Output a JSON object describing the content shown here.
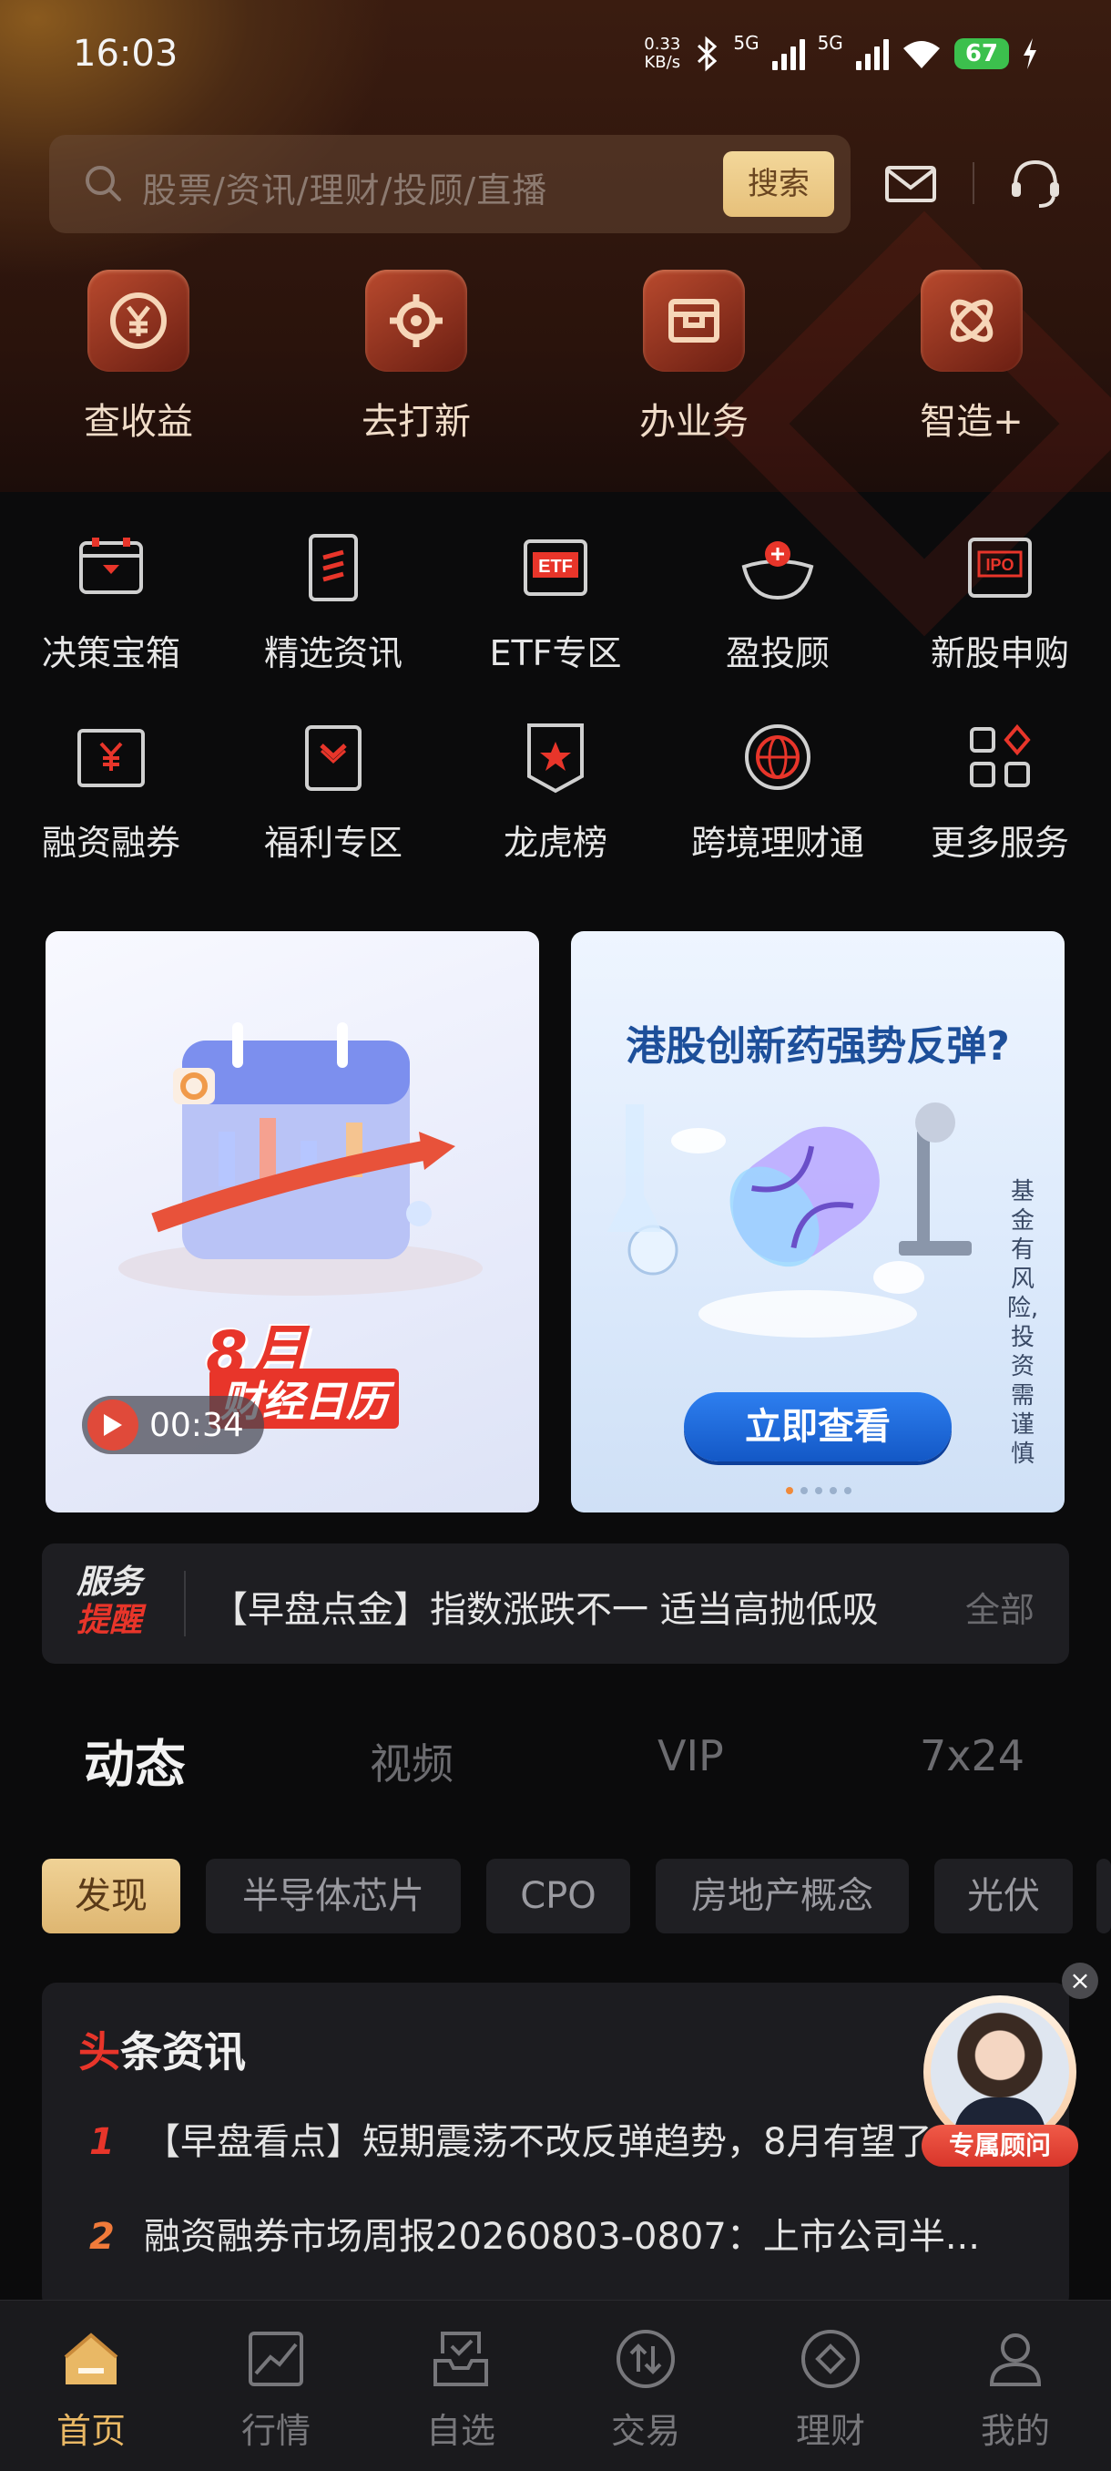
{
  "status_bar": {
    "time": "16:03",
    "net_speed": "0.33",
    "net_unit": "KB/s",
    "net1": "5G",
    "net2": "5G",
    "battery": "67"
  },
  "search": {
    "placeholder": "股票/资讯/理财/投顾/直播",
    "button": "搜索"
  },
  "quick_actions": [
    {
      "label": "查收益",
      "icon": "yen-coin-icon"
    },
    {
      "label": "去打新",
      "icon": "target-icon"
    },
    {
      "label": "办业务",
      "icon": "briefcase-icon"
    },
    {
      "label": "智造+",
      "icon": "atom-icon"
    }
  ],
  "menu_grid": [
    {
      "label": "决策宝箱",
      "icon": "treasure-box-icon"
    },
    {
      "label": "精选资讯",
      "icon": "news-doc-icon"
    },
    {
      "label": "ETF专区",
      "icon": "etf-icon",
      "icon_text": "ETF"
    },
    {
      "label": "盈投顾",
      "icon": "advisor-bowl-icon"
    },
    {
      "label": "新股申购",
      "icon": "ipo-icon",
      "icon_text": "IPO"
    },
    {
      "label": "融资融券",
      "icon": "yen-ticket-icon"
    },
    {
      "label": "福利专区",
      "icon": "gift-icon"
    },
    {
      "label": "龙虎榜",
      "icon": "star-badge-icon"
    },
    {
      "label": "跨境理财通",
      "icon": "globe-sync-icon"
    },
    {
      "label": "更多服务",
      "icon": "grid-more-icon"
    }
  ],
  "banners": {
    "left": {
      "title": "8月",
      "subtitle": "财经日历",
      "duration": "00:34"
    },
    "right": {
      "title": "港股创新药强势反弹?",
      "button": "立即查看",
      "risk": "基金有风险,投资需谨慎"
    }
  },
  "notice": {
    "tag_line1": "服务",
    "tag_line2": "提醒",
    "text": "【早盘点金】指数涨跌不一  适当高抛低吸",
    "all": "全部"
  },
  "feed_tabs": [
    "动态",
    "视频",
    "VIP",
    "7x24"
  ],
  "chips": [
    "发现",
    "半导体芯片",
    "CPO",
    "房地产概念",
    "光伏"
  ],
  "headline": {
    "title_first": "头",
    "title_rest": "条资讯",
    "items": [
      {
        "rank": "1",
        "text": "【早盘看点】短期震荡不改反弹趋势，8月有望了"
      },
      {
        "rank": "2",
        "text": "融资融券市场周报20260803-0807：上市公司半..."
      }
    ]
  },
  "advisor": {
    "label": "专属顾问",
    "close": "×"
  },
  "bottom_nav": [
    {
      "label": "首页",
      "icon": "home-icon",
      "active": true
    },
    {
      "label": "行情",
      "icon": "chart-icon",
      "active": false
    },
    {
      "label": "自选",
      "icon": "inbox-check-icon",
      "active": false
    },
    {
      "label": "交易",
      "icon": "trade-arrows-icon",
      "active": false
    },
    {
      "label": "理财",
      "icon": "diamond-circle-icon",
      "active": false
    },
    {
      "label": "我的",
      "icon": "person-icon",
      "active": false
    }
  ],
  "colors": {
    "accent_gold": "#e9b865",
    "brand_red": "#e8352a",
    "background": "#0b0b0c"
  }
}
